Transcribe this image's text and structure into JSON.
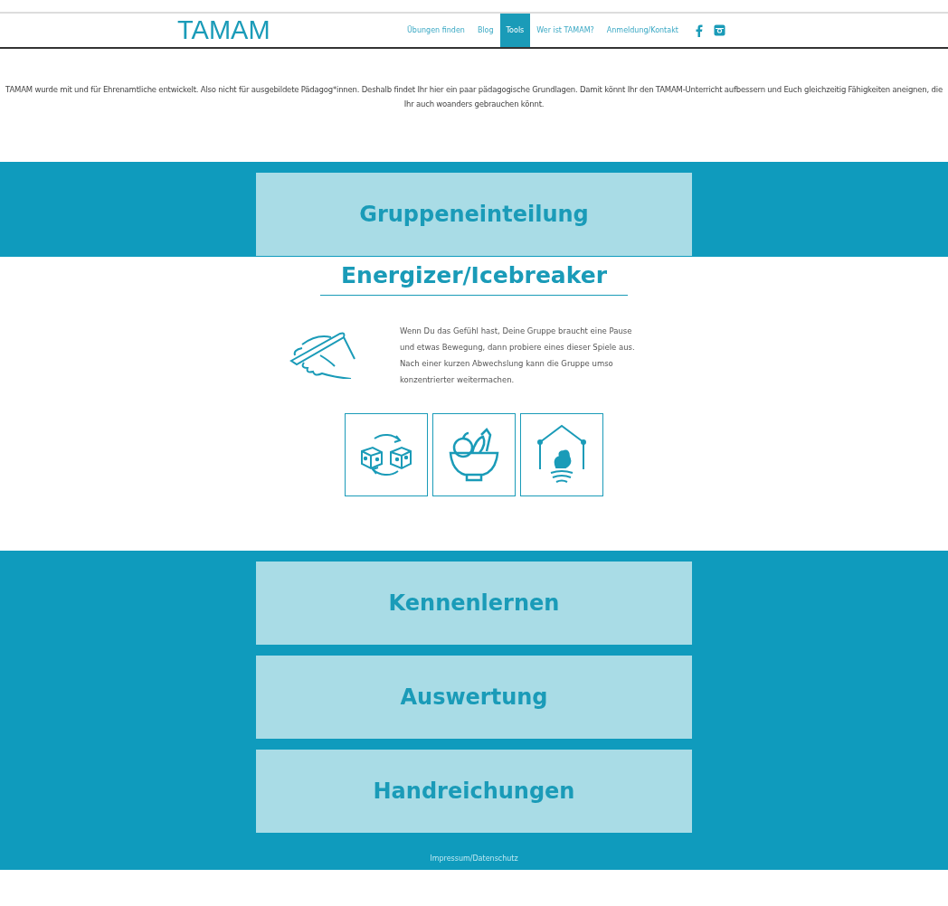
{
  "logo": "TAMAM",
  "nav": [
    {
      "label": "Übungen finden",
      "selected": false
    },
    {
      "label": "Blog",
      "selected": false
    },
    {
      "label": "Tools",
      "selected": true
    },
    {
      "label": "Wer ist TAMAM?",
      "selected": false
    },
    {
      "label": "Anmeldung/Kontakt",
      "selected": false
    }
  ],
  "intro": "TAMAM wurde mit und für Ehrenamtliche entwickelt. Also nicht für ausgebildete Pädagog*innen. Deshalb findet Ihr hier ein paar pädagogische Grundlagen. Damit könnt Ihr den TAMAM-Unterricht aufbessern und Euch gleichzeitig Fähigkeiten aneignen, die Ihr auch woanders gebrauchen könnt.",
  "sections": [
    {
      "title": "Gruppeneinteilung",
      "expanded": false
    },
    {
      "title": "Energizer/Icebreaker",
      "expanded": true,
      "description": "Wenn Du das Gefühl hast, Deine Gruppe braucht eine Pause und etwas Bewegung, dann probiere eines dieser Spiele aus. Nach einer kurzen Abwechslung kann die Gruppe umso konzentrierter weitermachen."
    },
    {
      "title": "Kennenlernen",
      "expanded": false
    },
    {
      "title": "Auswertung",
      "expanded": false
    },
    {
      "title": "Handreichungen",
      "expanded": false
    }
  ],
  "footer_link": "Impressum/Datenschutz"
}
